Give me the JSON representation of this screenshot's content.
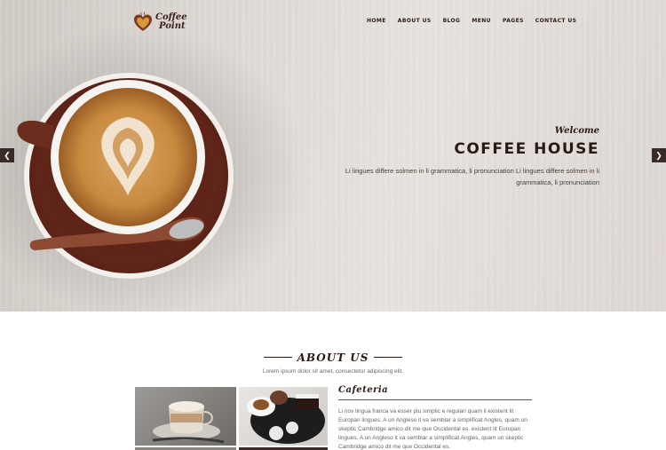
{
  "header": {
    "logo": {
      "line1": "Coffee",
      "line2": "Point"
    },
    "nav": [
      "HOME",
      "ABOUT US",
      "BLOG",
      "MENU",
      "PAGES",
      "CONTACT US"
    ]
  },
  "hero": {
    "welcome": "Welcome",
    "title": "COFFEE HOUSE",
    "description": "Li lingues differe solmen in li grammatica, li pronunciation Li lingues differe solmen in li grammatica, li pronunciation",
    "prev_icon": "chevron-left-icon",
    "next_icon": "chevron-right-icon"
  },
  "about": {
    "title": "ABOUT US",
    "subtitle": "Lorem ipsum dolor sit amet, consectetur adipiscing elit.",
    "card_title": "Cafeteria",
    "card_text": "Li nov lingua franca va esser plu simplic e regulari quam li existent lit Europan lingues. A un Angleso it va semblar a simplificat Angles, quam un skeptic Cambridge amico dit me que Occidental es. existent lit Europan lingues. A un Angleso it va semblar a simplificat Angles, quam un skeptic Cambridge amico dit me que Occidental es."
  },
  "colors": {
    "brand_dark": "#2a1a14",
    "slider_arrow": "#3a2b26",
    "saucer": "#6a2a1d",
    "coffee": "#c88a3f"
  }
}
